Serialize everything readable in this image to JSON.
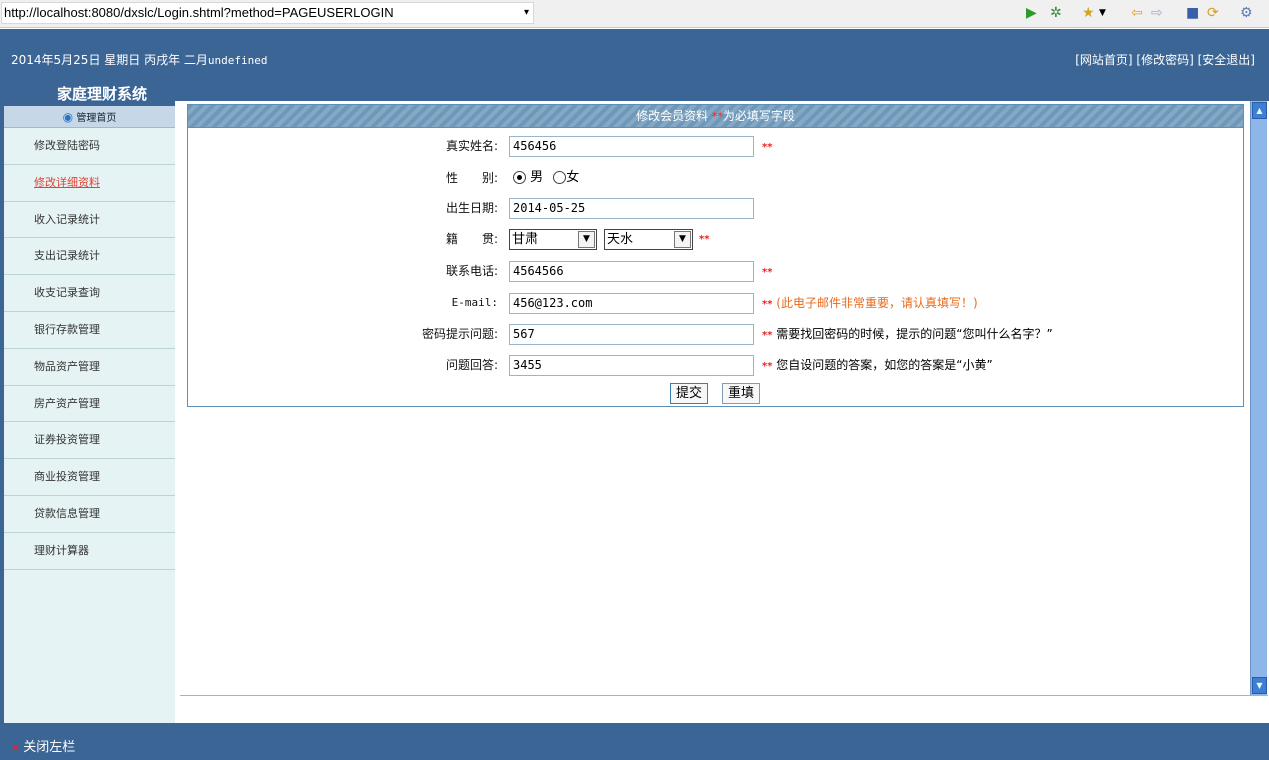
{
  "browser": {
    "url": "http://localhost:8080/dxslc/Login.shtml?method=PAGEUSERLOGIN",
    "dropdown_glyph": "▾",
    "icons": [
      "play-icon",
      "bug-icon",
      "star-icon",
      "back-icon",
      "forward-icon",
      "stop-icon",
      "refresh-icon",
      "settings-icon"
    ]
  },
  "header": {
    "date_cn": "2014年5月25日 星期日 丙戌年 二月",
    "date_suffix": "undefined",
    "links": [
      "[网站首页]",
      "[修改密码]",
      "[安全退出]"
    ],
    "app_title": "家庭理财系统"
  },
  "sidebar": {
    "head": "管理首页",
    "items": [
      "修改登陆密码",
      "修改详细资料",
      "收入记录统计",
      "支出记录统计",
      "收支记录查询",
      "银行存款管理",
      "物品资产管理",
      "房产资产管理",
      "证券投资管理",
      "商业投资管理",
      "贷款信息管理",
      "理财计算器"
    ]
  },
  "form": {
    "title": "修改会员资料",
    "title_req": "**",
    "title_suffix": "为必填写字段",
    "req_mark": "**",
    "name_label": "真实姓名:",
    "name_value": "456456",
    "gender_label": "性　　别:",
    "gender_male": "男",
    "gender_female": "女",
    "birth_label": "出生日期:",
    "birth_value": "2014-05-25",
    "origin_label": "籍　　贯:",
    "province": "甘肃",
    "city": "天水",
    "phone_label": "联系电话:",
    "phone_value": "4564566",
    "email_label": "E-mail:",
    "email_value": "456@123.com",
    "email_note": "(此电子邮件非常重要，请认真填写！)",
    "question_label": "密码提示问题:",
    "question_value": "567",
    "question_note": "需要找回密码的时候，提示的问题“您叫什么名字？”",
    "answer_label": "问题回答:",
    "answer_value": "3455",
    "answer_note": "您自设问题的答案，如您的答案是“小黄”",
    "submit": "提交",
    "reset": "重填"
  },
  "footer": {
    "close_sidebar": "关闭左栏",
    "close_mark": "×"
  }
}
